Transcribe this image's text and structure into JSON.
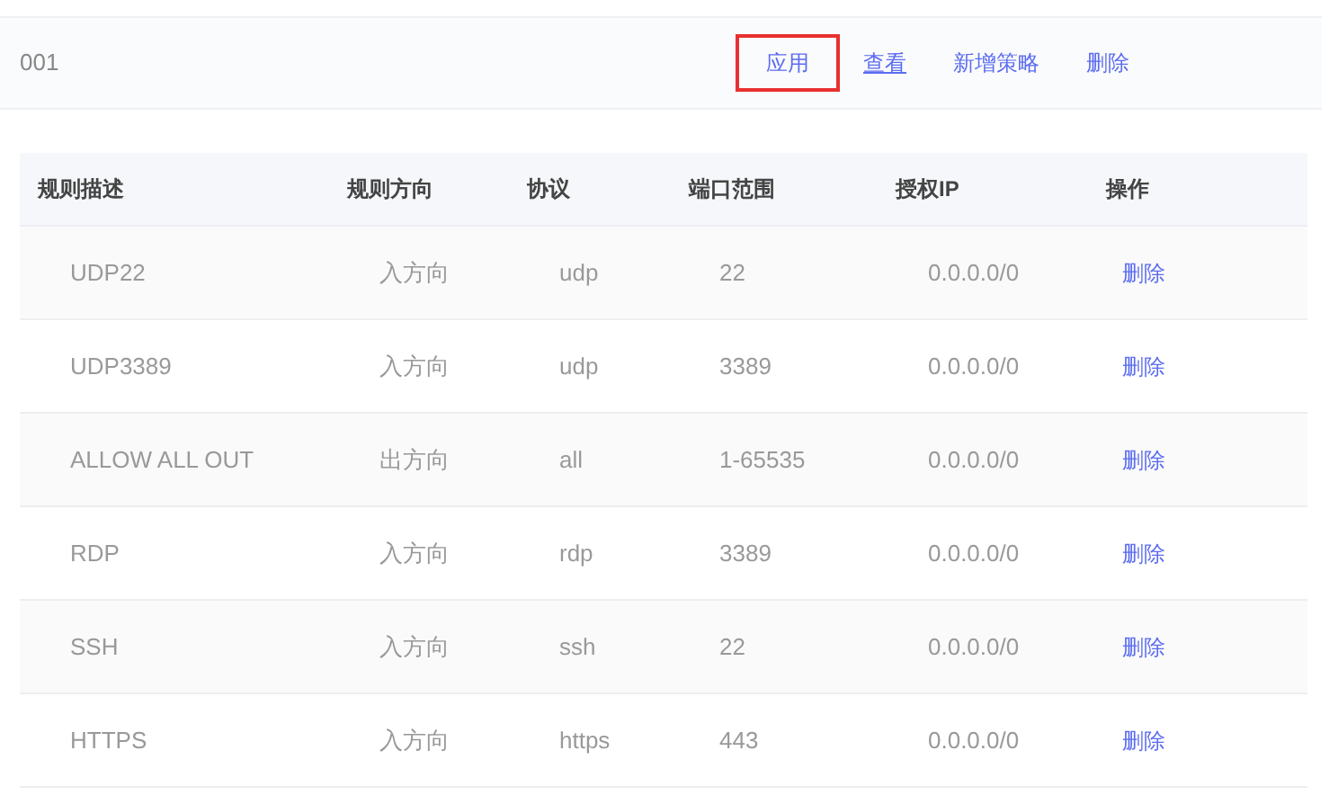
{
  "policy": {
    "name": "001",
    "actions": [
      {
        "label": "应用",
        "highlighted": true,
        "underlined": false
      },
      {
        "label": "查看",
        "highlighted": false,
        "underlined": true
      },
      {
        "label": "新增策略",
        "highlighted": false,
        "underlined": false
      },
      {
        "label": "删除",
        "highlighted": false,
        "underlined": false
      }
    ]
  },
  "table": {
    "columns": [
      "规则描述",
      "规则方向",
      "协议",
      "端口范围",
      "授权IP",
      "操作"
    ],
    "rows": [
      {
        "cells": [
          "UDP22",
          "入方向",
          "udp",
          "22",
          "0.0.0.0/0"
        ],
        "action": "删除"
      },
      {
        "cells": [
          "UDP3389",
          "入方向",
          "udp",
          "3389",
          "0.0.0.0/0"
        ],
        "action": "删除"
      },
      {
        "cells": [
          "ALLOW ALL OUT",
          "出方向",
          "all",
          "1-65535",
          "0.0.0.0/0"
        ],
        "action": "删除"
      },
      {
        "cells": [
          "RDP",
          "入方向",
          "rdp",
          "3389",
          "0.0.0.0/0"
        ],
        "action": "删除"
      },
      {
        "cells": [
          "SSH",
          "入方向",
          "ssh",
          "22",
          "0.0.0.0/0"
        ],
        "action": "删除"
      },
      {
        "cells": [
          "HTTPS",
          "入方向",
          "https",
          "443",
          "0.0.0.0/0"
        ],
        "action": "删除"
      }
    ]
  }
}
